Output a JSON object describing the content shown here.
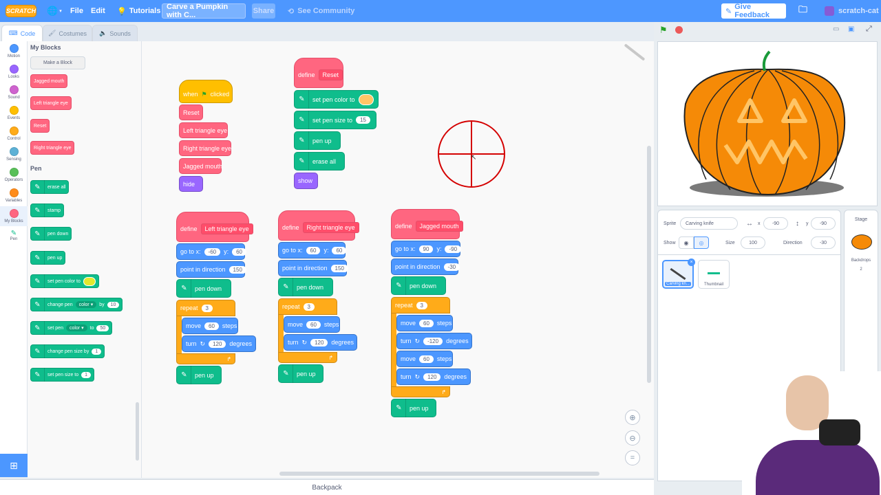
{
  "menubar": {
    "logo": "SCRATCH",
    "file": "File",
    "edit": "Edit",
    "tutorials": "Tutorials",
    "project_title": "Carve a Pumpkin with C...",
    "share": "Share",
    "see_community": "See Community",
    "give_feedback": "Give Feedback",
    "username": "scratch-cat"
  },
  "tabs": {
    "code": "Code",
    "costumes": "Costumes",
    "sounds": "Sounds"
  },
  "categories": [
    {
      "label": "Motion",
      "color": "#4c97ff"
    },
    {
      "label": "Looks",
      "color": "#9966ff"
    },
    {
      "label": "Sound",
      "color": "#cf63cf"
    },
    {
      "label": "Events",
      "color": "#ffbf00"
    },
    {
      "label": "Control",
      "color": "#ffab19"
    },
    {
      "label": "Sensing",
      "color": "#5cb1d6"
    },
    {
      "label": "Operators",
      "color": "#59c059"
    },
    {
      "label": "Variables",
      "color": "#ff8c1a"
    },
    {
      "label": "My Blocks",
      "color": "#ff6680"
    },
    {
      "label": "Pen",
      "color": "#0fbd8c"
    }
  ],
  "flyout": {
    "my_blocks_heading": "My Blocks",
    "make_block": "Make a Block",
    "my_blocks": [
      "Jagged mouth",
      "Left triangle eye",
      "Reset",
      "Right triangle eye"
    ],
    "pen_heading": "Pen",
    "erase_all": "erase all",
    "stamp": "stamp",
    "pen_down": "pen down",
    "pen_up": "pen up",
    "set_pen_color_to": "set pen color to",
    "change_pen": "change pen",
    "color": "color",
    "by": "by",
    "change_by_value": "10",
    "set_pen": "set pen",
    "to": "to",
    "set_to_value": "50",
    "change_pen_size_by": "change pen size by",
    "change_size_value": "1",
    "set_pen_size_to": "set pen size to",
    "set_size_value": "1"
  },
  "script1": {
    "when": "when",
    "clicked": "clicked",
    "calls": [
      "Reset",
      "Left triangle eye",
      "Right triangle eye",
      "Jagged mouth"
    ],
    "hide": "hide"
  },
  "script2": {
    "define": "define",
    "name": "Reset",
    "set_pen_color": "set pen color to",
    "set_pen_size": "set pen size to",
    "size": "15",
    "pen_up": "pen up",
    "erase_all": "erase all",
    "show": "show"
  },
  "script3": {
    "define": "define",
    "name": "Left triangle eye",
    "go_to_x": "go to x:",
    "x": "-60",
    "y_label": "y:",
    "y": "60",
    "point": "point in direction",
    "dir": "150",
    "pen_down": "pen down",
    "repeat": "repeat",
    "times": "3",
    "move": "move",
    "steps_val": "60",
    "steps": "steps",
    "turn": "turn",
    "deg_val": "120",
    "degrees": "degrees",
    "pen_up": "pen up"
  },
  "script4": {
    "define": "define",
    "name": "Right triangle eye",
    "go_to_x": "go to x:",
    "x": "60",
    "y_label": "y:",
    "y": "60",
    "point": "point in direction",
    "dir": "150",
    "pen_down": "pen down",
    "repeat": "repeat",
    "times": "3",
    "move": "move",
    "steps_val": "60",
    "steps": "steps",
    "turn": "turn",
    "deg_val": "120",
    "degrees": "degrees",
    "pen_up": "pen up"
  },
  "script5": {
    "define": "define",
    "name": "Jagged mouth",
    "go_to_x": "go to x:",
    "x": "90",
    "y_label": "y:",
    "y": "-90",
    "point": "point in direction",
    "dir": "-30",
    "pen_down": "pen down",
    "repeat": "repeat",
    "times": "3",
    "move": "move",
    "steps_val": "60",
    "steps": "steps",
    "turn": "turn",
    "deg_val1": "-120",
    "deg_val2": "120",
    "degrees": "degrees",
    "pen_up": "pen up"
  },
  "backpack": "Backpack",
  "sprite_info": {
    "sprite_label": "Sprite",
    "sprite_name": "Carving knife",
    "x_label": "x",
    "x": "-90",
    "y_label": "y",
    "y": "-90",
    "show_label": "Show",
    "size_label": "Size",
    "size": "100",
    "direction_label": "Direction",
    "direction": "-30"
  },
  "sprites": [
    {
      "name": "Carving kn..."
    },
    {
      "name": "Thumbnail"
    }
  ],
  "stage_pane": {
    "title": "Stage",
    "backdrops": "Backdrops",
    "count": "2"
  },
  "colors": {
    "pumpkin": "#f58a07",
    "pen_color": "#ffc566",
    "crosshair": "#d40000"
  }
}
